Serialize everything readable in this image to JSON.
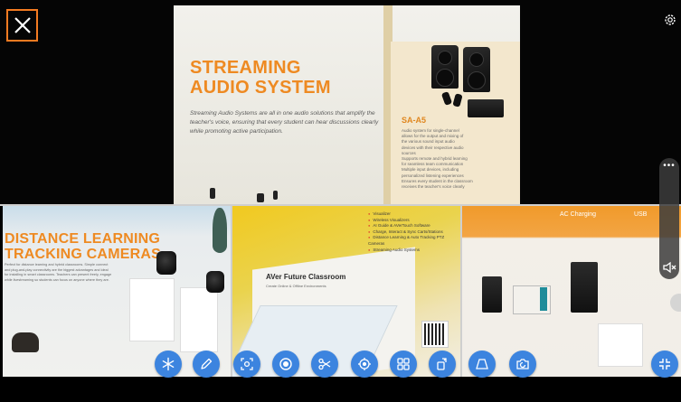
{
  "main_feed": {
    "title": "STREAMING AUDIO SYSTEM",
    "description": "Streaming Audio Systems are all in one audio solutions that amplify the teacher's voice, ensuring that every student can hear discussions clearly while promoting active participation.",
    "model": "SA-A5",
    "bullets": [
      "Audio system for single-channel",
      "allows for the output and mixing of",
      "the various sound input audio",
      "devices with their respective audio",
      "sources",
      "Supports remote and hybrid learning",
      "for seamless team communication",
      "Multiple input devices, including",
      "personalized listening experiences",
      "Ensures every student in the classroom",
      "receives the teacher's voice clearly"
    ]
  },
  "tile_distance": {
    "title_line1": "DISTANCE LEARNING",
    "title_line2": "TRACKING CAMERAS",
    "description": "Perfect for distance learning and hybrid classrooms. Simple connect and plug-and-play connectivity are the biggest advantages and ideal for installing in smart classrooms. Teachers can present freely, engage while livestreaming so students can focus on anyone where they are."
  },
  "tile_future": {
    "title": "AVer Future Classroom",
    "subtitle": "Create Online & Offline Environments",
    "list": [
      "Visualizer",
      "Wireless Visualizers",
      "AI Guide & AVerTouch Software",
      "Charge, Interact & Sync Carts/Stations",
      "Distance Learning & Auto Tracking PTZ Cameras",
      "Streaming Audio Systems"
    ]
  },
  "tile_charging": {
    "label_left": "AC Charging",
    "label_right": "USB"
  },
  "toolbar": {
    "buttons": [
      {
        "name": "freeze-button",
        "icon": "snowflake-icon"
      },
      {
        "name": "annotate-button",
        "icon": "pen-icon"
      },
      {
        "name": "focus-button",
        "icon": "focus-icon"
      },
      {
        "name": "record-button",
        "icon": "record-icon"
      },
      {
        "name": "capture-button",
        "icon": "scissors-icon"
      },
      {
        "name": "crosshair-button",
        "icon": "crosshair-icon"
      },
      {
        "name": "layout-button",
        "icon": "grid-icon"
      },
      {
        "name": "rotate-button",
        "icon": "rotate-icon"
      },
      {
        "name": "keystone-button",
        "icon": "keystone-icon"
      },
      {
        "name": "camera-switch-button",
        "icon": "camera-rotate-icon"
      },
      {
        "name": "exit-fullscreen-button",
        "icon": "collapse-icon"
      }
    ]
  },
  "overlay": {
    "close_icon": "close-icon",
    "settings_icon": "gear-icon",
    "more_icon": "more-icon",
    "mute_icon": "speaker-mute-icon",
    "accent_color": "#f37b21",
    "button_color": "#3c84df"
  }
}
